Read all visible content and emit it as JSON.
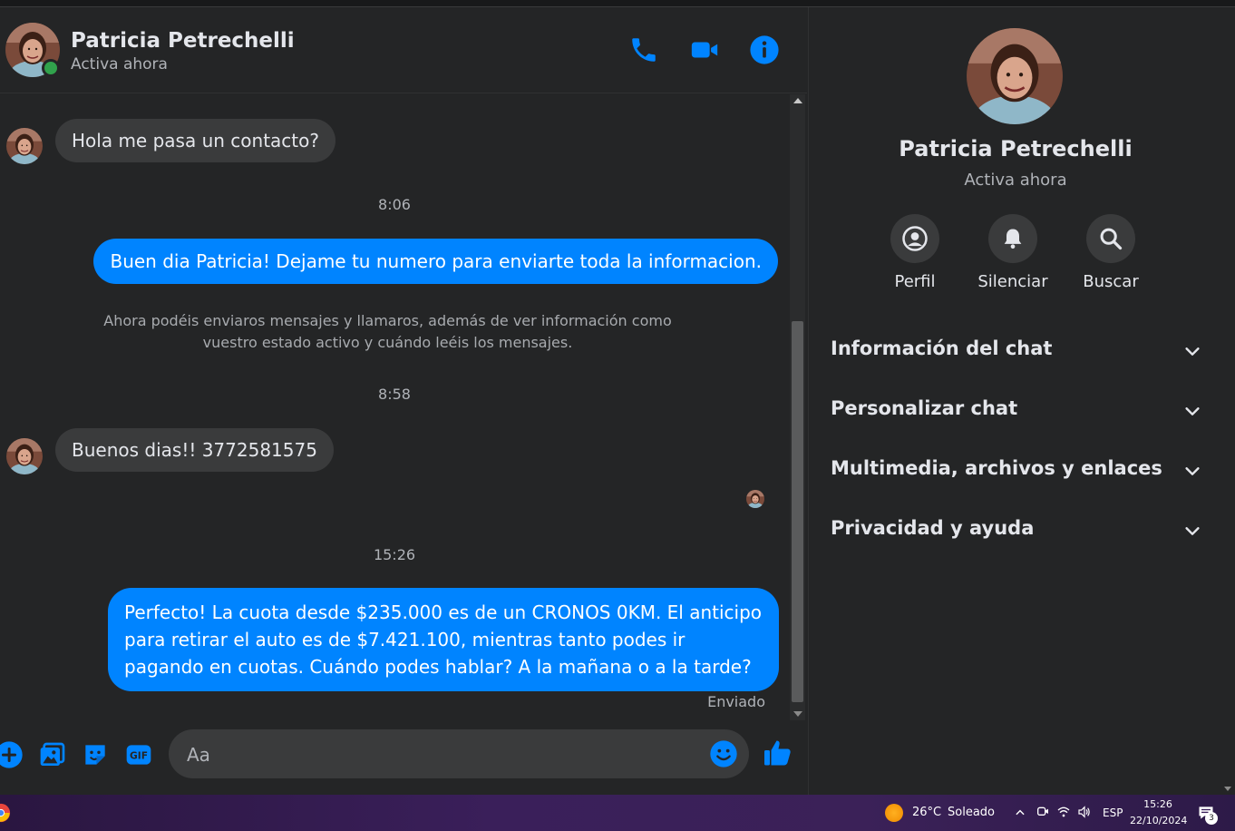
{
  "contact": {
    "name": "Patricia Petrechelli",
    "status": "Activa ahora"
  },
  "messages": {
    "in1": "Hola me pasa un contacto?",
    "time1": "8:06",
    "out1": "Buen dia Patricia! Dejame tu numero para enviarte toda la informacion.",
    "system": "Ahora podéis enviaros mensajes y llamaros, además de ver información como vuestro estado activo y cuándo leéis los mensajes.",
    "time2": "8:58",
    "in2": "Buenos dias!! 3772581575",
    "time3": "15:26",
    "out2": "Perfecto! La cuota desde $235.000 es de un CRONOS 0KM. El anticipo para retirar el auto es de $7.421.100, mientras tanto podes ir pagando en cuotas. Cuándo podes hablar? A la mañana o a la tarde?",
    "sent_status": "Enviado"
  },
  "composer": {
    "placeholder": "Aa"
  },
  "side": {
    "actions": {
      "profile": "Perfil",
      "mute": "Silenciar",
      "search": "Buscar"
    },
    "sections": {
      "info": "Información del chat",
      "customize": "Personalizar chat",
      "media": "Multimedia, archivos y enlaces",
      "privacy": "Privacidad y ayuda"
    }
  },
  "taskbar": {
    "weather": "26°C",
    "weather_desc": "Soleado",
    "lang": "ESP",
    "time": "15:26",
    "date": "22/10/2024",
    "notifications": "3"
  },
  "colors": {
    "accent": "#0084ff",
    "background": "#242526",
    "bubble_in": "#3a3b3c",
    "online": "#31a24c"
  }
}
